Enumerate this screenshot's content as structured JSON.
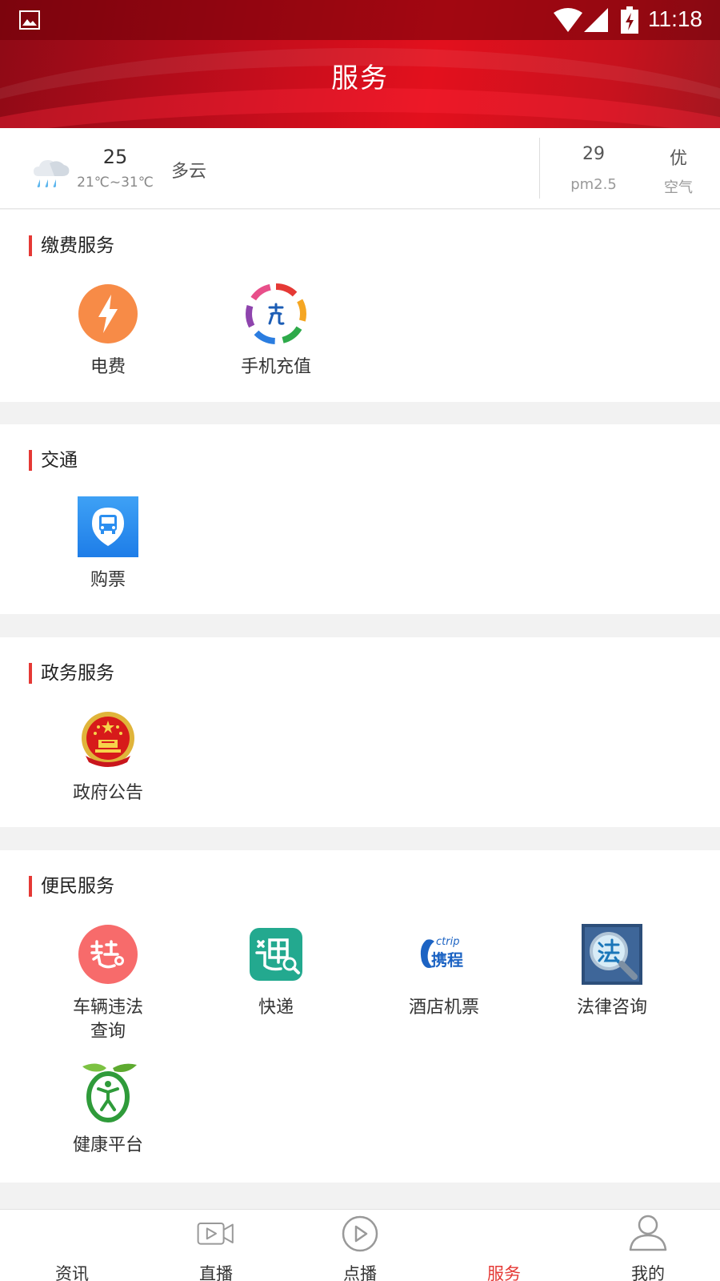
{
  "status_bar": {
    "time": "11:18"
  },
  "header": {
    "title": "服务"
  },
  "weather": {
    "temperature": "25",
    "range": "21℃~31℃",
    "condition": "多云",
    "pm_value": "29",
    "pm_label": "pm2.5",
    "air_value": "优",
    "air_label": "空气"
  },
  "sections": [
    {
      "title": "缴费服务",
      "items": [
        {
          "label": "电费",
          "icon": "lightning-icon"
        },
        {
          "label": "手机充值",
          "icon": "phone-recharge-icon"
        }
      ]
    },
    {
      "title": "交通",
      "items": [
        {
          "label": "购票",
          "icon": "bus-icon"
        }
      ]
    },
    {
      "title": "政务服务",
      "items": [
        {
          "label": "政府公告",
          "icon": "national-emblem-icon"
        }
      ]
    },
    {
      "title": "便民服务",
      "items": [
        {
          "label": "车辆违法查询",
          "icon": "traffic-violation-icon"
        },
        {
          "label": "快递",
          "icon": "express-delivery-icon"
        },
        {
          "label": "酒店机票",
          "icon": "ctrip-icon",
          "logo_text": "ctrip",
          "logo_name": "携程"
        },
        {
          "label": "法律咨询",
          "icon": "legal-consult-icon"
        },
        {
          "label": "健康平台",
          "icon": "health-platform-icon"
        }
      ]
    }
  ],
  "nav": [
    {
      "label": "资讯",
      "icon": "news-icon",
      "active": false
    },
    {
      "label": "直播",
      "icon": "live-video-icon",
      "active": false
    },
    {
      "label": "点播",
      "icon": "play-icon",
      "active": false
    },
    {
      "label": "服务",
      "icon": "service-icon",
      "active": true
    },
    {
      "label": "我的",
      "icon": "profile-icon",
      "active": false
    }
  ],
  "colors": {
    "accent": "#e53935",
    "header_red": "#d20f1c"
  }
}
